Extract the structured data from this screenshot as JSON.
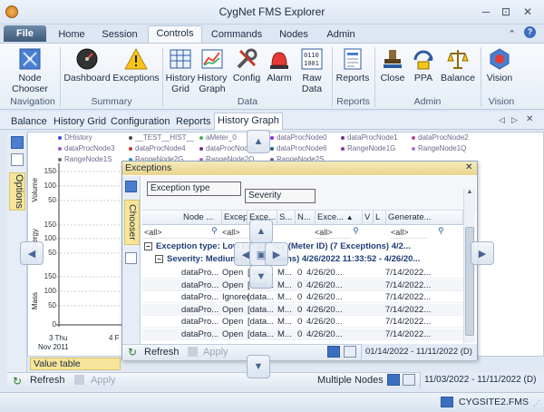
{
  "window": {
    "title": "CygNet FMS Explorer"
  },
  "tabs": {
    "file": "File",
    "items": [
      "Home",
      "Session",
      "Controls",
      "Commands",
      "Nodes",
      "Admin"
    ]
  },
  "ribbon": {
    "node_chooser": "Node\nChooser",
    "dashboard": "Dashboard",
    "exceptions": "Exceptions",
    "history_grid": "History\nGrid",
    "history_graph": "History\nGraph",
    "config": "Config",
    "alarm": "Alarm",
    "raw_data": "Raw\nData",
    "reports": "Reports",
    "close": "Close",
    "ppa": "PPA",
    "balance": "Balance",
    "vision": "Vision",
    "groups": {
      "navigation": "Navigation",
      "summary": "Summary",
      "data": "Data",
      "reports": "Reports",
      "admin": "Admin",
      "vision": "Vision"
    }
  },
  "doc_tabs": [
    "Balance",
    "History Grid",
    "Configuration",
    "Reports",
    "History Graph"
  ],
  "options": {
    "label": "Options",
    "value_table": "Value table",
    "refresh": "Refresh",
    "apply": "Apply",
    "nodes": "Multiple Nodes",
    "range": "11/03/2022 - 11/11/2022 (D)"
  },
  "graph": {
    "legend": [
      "DHistory",
      "__TEST__HIST__",
      "aMeter_0",
      "dataProcNode0",
      "dataProcNode1",
      "dataProcNode2",
      "dataProcNode3",
      "dataProcNode4",
      "dataProcNode5",
      "dataProcNode6",
      "RangeNode1G",
      "RangeNode1Q",
      "RangeNode1S",
      "RangeNode2G",
      "RangeNode2Q",
      "RangeNode2S"
    ],
    "legend_colors": [
      "#3a4dd0",
      "#4a4a4a",
      "#4caf50",
      "#8a2be2",
      "#7a2b8a",
      "#b24d8e",
      "#9b59b6",
      "#c0392b",
      "#6c3483",
      "#1f618d",
      "#7d3c98",
      "#af7ac5",
      "#5d6d7e",
      "#2e86c1",
      "#a569bd",
      "#884ea0"
    ],
    "y_labels": [
      "Volume",
      "Energy",
      "Mass"
    ],
    "ticks_volume": [
      "150",
      "100",
      "50"
    ],
    "ticks_energy": [
      "150",
      "100",
      "50"
    ],
    "ticks_mass": [
      "150",
      "100",
      "50",
      "0"
    ],
    "x_labels": [
      "3 Thu",
      "4 F"
    ],
    "x_sub": "Nov 2011"
  },
  "exceptions": {
    "title": "Exceptions",
    "chooser": "Chooser",
    "chip1": "Exception type",
    "chip2": "Severity",
    "columns": [
      "Node ...",
      "Excep...",
      "Exce...",
      "S...",
      "N...",
      "Exce...",
      "V",
      "L",
      "Generate..."
    ],
    "filter_all": "<all>",
    "group1": "Exception type: Low Frequency (Meter ID) (7 Exceptions) 4/2...",
    "group2": "Severity: Medium (7 Exceptions) 4/26/2022 11:33:52 - 4/26/20...",
    "rows": [
      [
        "dataPro...",
        "Open",
        "[data...",
        "M...",
        "0",
        "4/26/20...",
        "7/14/2022..."
      ],
      [
        "dataPro...",
        "Open",
        "[data...",
        "M...",
        "0",
        "4/26/20...",
        "7/14/2022..."
      ],
      [
        "dataPro...",
        "Ignored",
        "[data...",
        "M...",
        "0",
        "4/26/20...",
        "7/14/2022..."
      ],
      [
        "dataPro...",
        "Open",
        "[data...",
        "M...",
        "0",
        "4/26/20...",
        "7/14/2022..."
      ],
      [
        "dataPro...",
        "Open",
        "[data...",
        "M...",
        "0",
        "4/26/20...",
        "7/14/2022..."
      ],
      [
        "dataPro...",
        "Open",
        "[data...",
        "M...",
        "0",
        "4/26/20...",
        "7/14/2022..."
      ]
    ],
    "refresh": "Refresh",
    "apply": "Apply",
    "range": "01/14/2022 - 11/11/2022 (D)"
  },
  "status": {
    "site": "CYGSITE2.FMS"
  }
}
